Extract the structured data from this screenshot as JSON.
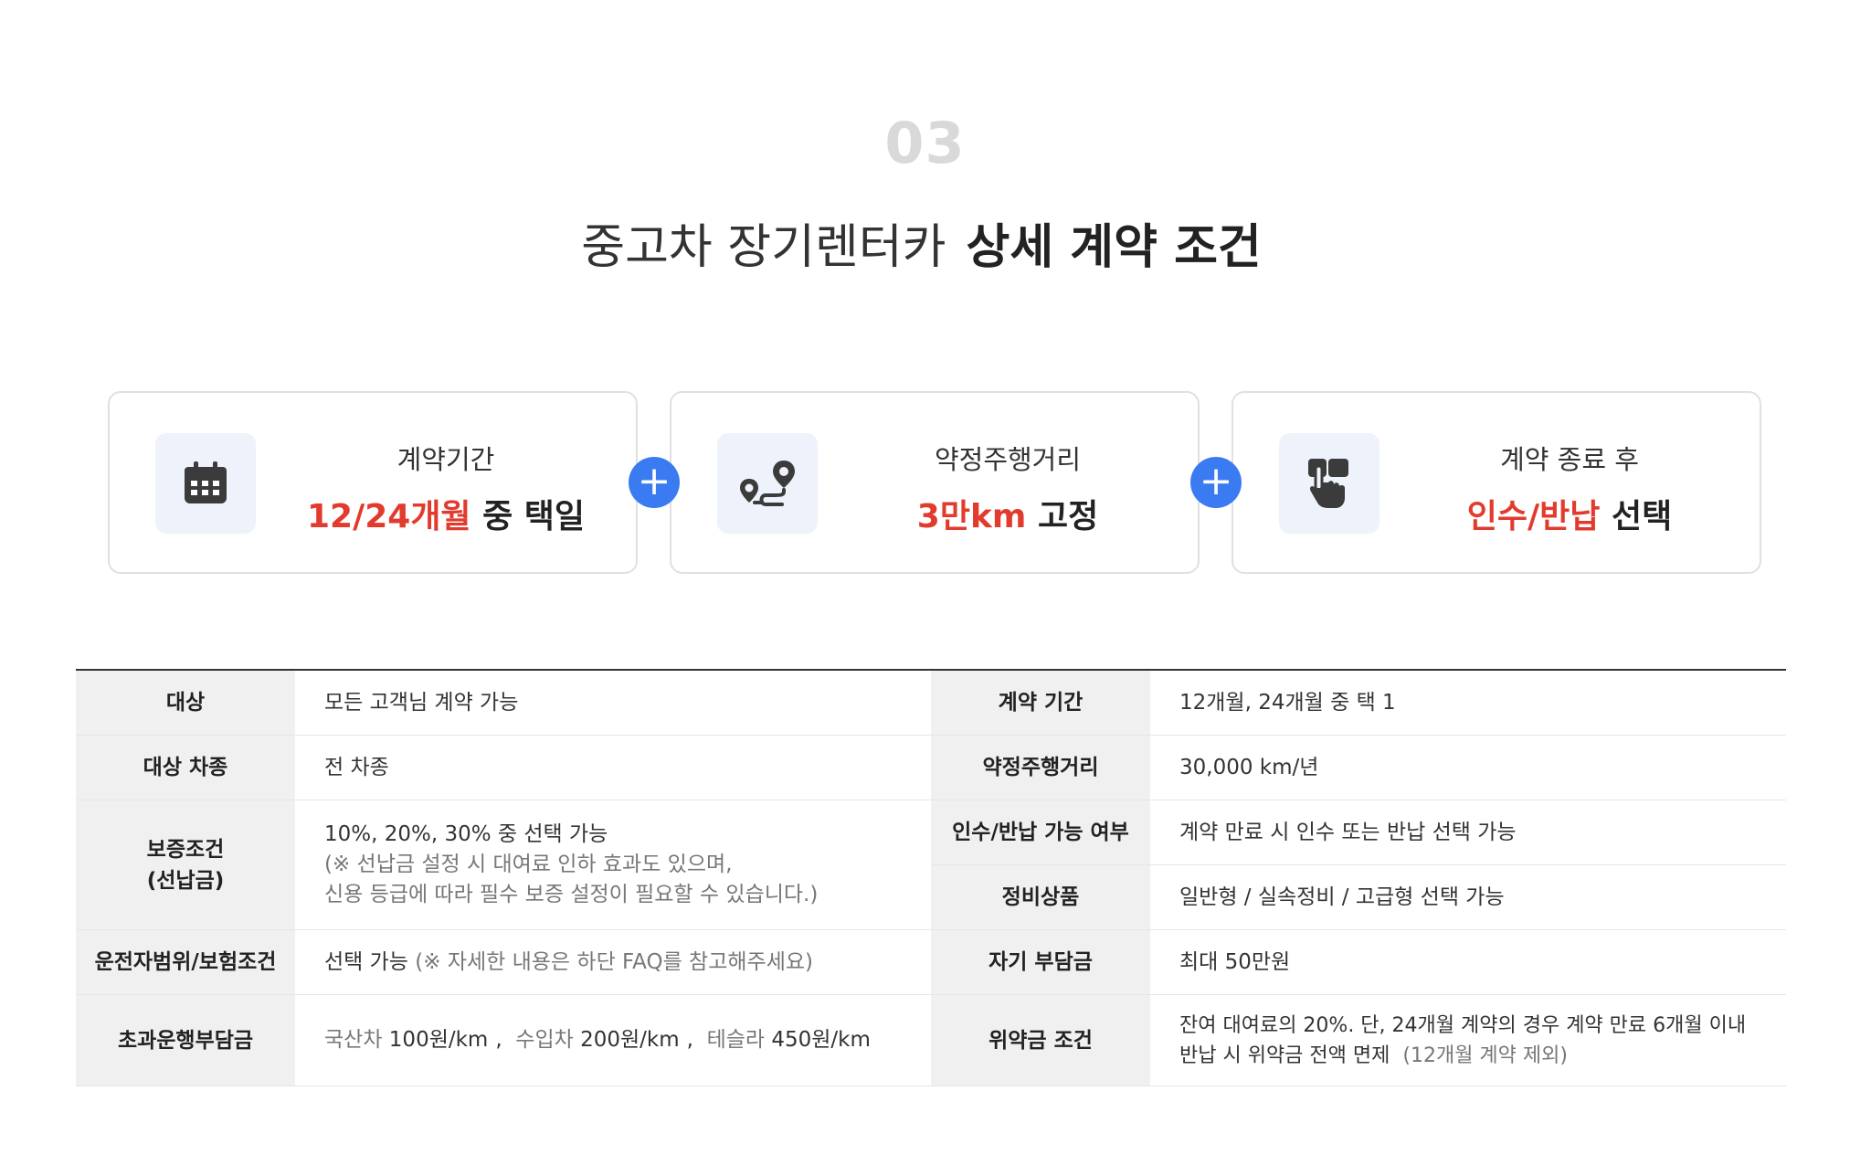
{
  "section": {
    "number": "03",
    "title_light": "중고차 장기렌터카",
    "title_highlight": "상세 계약 조건"
  },
  "cards": [
    {
      "icon": "calendar-icon",
      "label": "계약기간",
      "value_red": "12/24개월",
      "value_rest": "중 택일"
    },
    {
      "icon": "route-map-icon",
      "label": "약정주행거리",
      "value_red": "3만km",
      "value_rest": "고정"
    },
    {
      "icon": "hand-touch-icon",
      "label": "계약 종료 후",
      "value_red": "인수/반납",
      "value_rest": "선택"
    }
  ],
  "plus_symbol": "+",
  "colors": {
    "accent_red": "#e23b2e",
    "plus_blue": "#3b7bf2",
    "highlight": "#c7ecf9",
    "icon_bg": "#eef2fb"
  },
  "table": {
    "left": [
      {
        "header": "대상",
        "lines": [
          "모든 고객님 계약 가능"
        ]
      },
      {
        "header": "대상 차종",
        "lines": [
          "전 차종"
        ]
      },
      {
        "header_lines": [
          "보증조건",
          "(선납금)"
        ],
        "lines": [
          "10%, 20%, 30% 중 선택 가능"
        ],
        "note_lines": [
          "(※ 선납금 설정 시 대여료 인하 효과도 있으며,",
          "신용 등급에 따라 필수 보증 설정이 필요할 수 있습니다.)"
        ]
      },
      {
        "header": "운전자범위/보험조건",
        "main": "선택 가능",
        "note": "(※ 자세한 내용은 하단 FAQ를 참고해주세요)"
      },
      {
        "header": "초과운행부담금",
        "fees": [
          {
            "label": "국산차",
            "price": "100원/km"
          },
          {
            "label": "수입차",
            "price": "200원/km"
          },
          {
            "label": "테슬라",
            "price": "450원/km"
          }
        ],
        "separator": ","
      }
    ],
    "right": [
      {
        "header": "계약 기간",
        "lines": [
          "12개월, 24개월 중 택 1"
        ]
      },
      {
        "header": "약정주행거리",
        "lines": [
          "30,000 km/년"
        ]
      },
      {
        "header": "인수/반납 가능 여부",
        "lines": [
          "계약 만료 시 인수 또는 반납 선택 가능"
        ]
      },
      {
        "header": "정비상품",
        "lines": [
          "일반형 / 실속정비 / 고급형 선택 가능"
        ]
      },
      {
        "header": "자기 부담금",
        "lines": [
          "최대 50만원"
        ]
      },
      {
        "header": "위약금 조건",
        "line1": "잔여 대여료의 20%. 단, 24개월 계약의 경우 계약 만료 6개월 이내",
        "line2_main": "반납 시 위약금 전액 면제",
        "line2_note": "(12개월 계약 제외)"
      }
    ]
  }
}
